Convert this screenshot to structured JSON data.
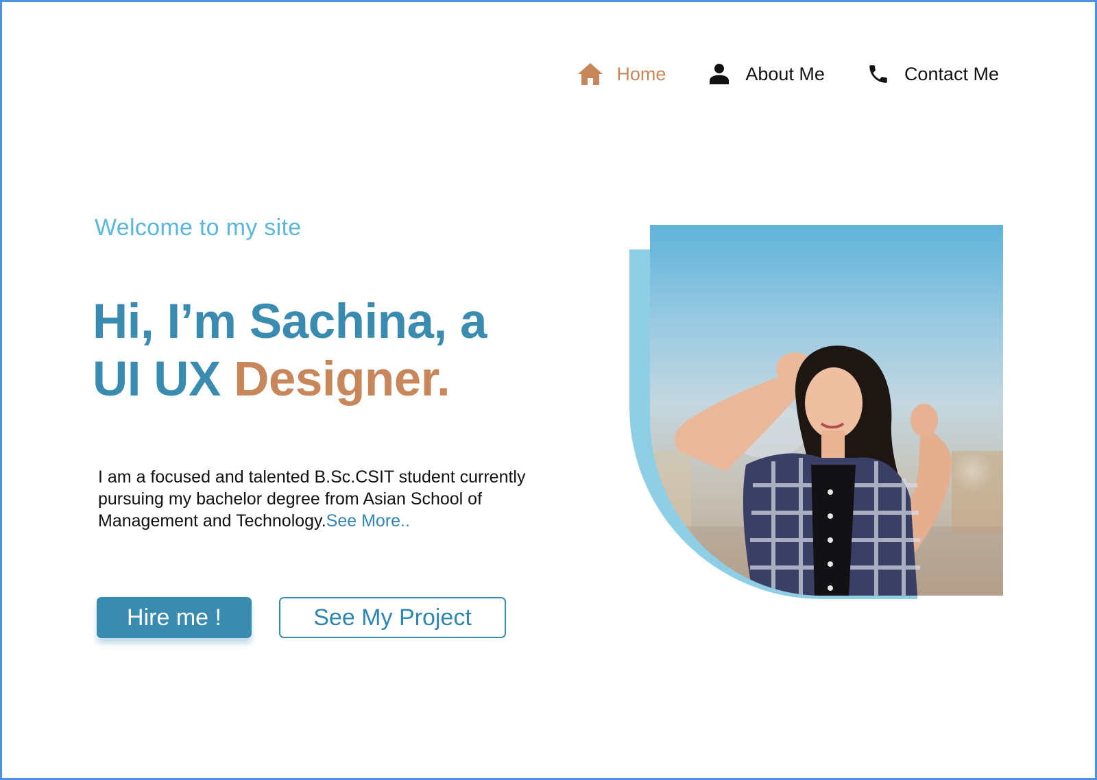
{
  "nav": {
    "items": [
      {
        "label": "Home",
        "icon": "home-icon",
        "active": true
      },
      {
        "label": "About Me",
        "icon": "person-icon",
        "active": false
      },
      {
        "label": "Contact Me",
        "icon": "phone-icon",
        "active": false
      }
    ]
  },
  "hero": {
    "welcome": "Welcome to my site",
    "headline_line1": "Hi, I’m Sachina, a",
    "headline_line2_part1": "UI UX",
    "headline_line2_part2": "Designer.",
    "bio": "I am a focused and talented B.Sc.CSIT student currently pursuing my bachelor degree from Asian School of Management and Technology.",
    "see_more": "See More..",
    "hire_button": "Hire me !",
    "project_button": "See My Project"
  },
  "colors": {
    "primary": "#3a8bb0",
    "accent": "#c8875a",
    "light_blue": "#5bb6db",
    "frame_border": "#4a90e2",
    "photo_backer": "#8fcfe6"
  }
}
